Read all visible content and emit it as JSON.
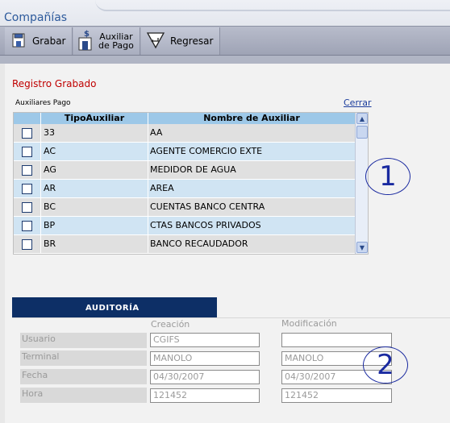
{
  "app": {
    "title": "Compañías"
  },
  "toolbar": {
    "save_label": "Grabar",
    "aux_label_line1": "Auxiliar",
    "aux_label_line2": "de Pago",
    "back_label": "Regresar"
  },
  "status": {
    "message": "Registro Grabado"
  },
  "aux_panel": {
    "title": "Auxiliares Pago",
    "close_label": "Cerrar",
    "columns": [
      "TipoAuxiliar",
      "Nombre de Auxiliar"
    ],
    "rows": [
      {
        "code": "33",
        "name": "AA"
      },
      {
        "code": "AC",
        "name": "AGENTE COMERCIO EXTE"
      },
      {
        "code": "AG",
        "name": "MEDIDOR DE AGUA"
      },
      {
        "code": "AR",
        "name": "AREA"
      },
      {
        "code": "BC",
        "name": "CUENTAS BANCO CENTRA"
      },
      {
        "code": "BP",
        "name": "CTAS BANCOS PRIVADOS"
      },
      {
        "code": "BR",
        "name": "BANCO RECAUDADOR"
      }
    ],
    "annotation": "1"
  },
  "audit": {
    "tab_label": "AUDITORÍA",
    "col_creation": "Creación",
    "col_modification": "Modificación",
    "labels": {
      "user": "Usuario",
      "terminal": "Terminal",
      "date": "Fecha",
      "time": "Hora"
    },
    "creation": {
      "user": "CGIFS",
      "terminal": "MANOLO",
      "date": "04/30/2007",
      "time": "121452"
    },
    "modification": {
      "user": "",
      "terminal": "MANOLO",
      "date": "04/30/2007",
      "time": "121452"
    },
    "annotation": "2"
  }
}
